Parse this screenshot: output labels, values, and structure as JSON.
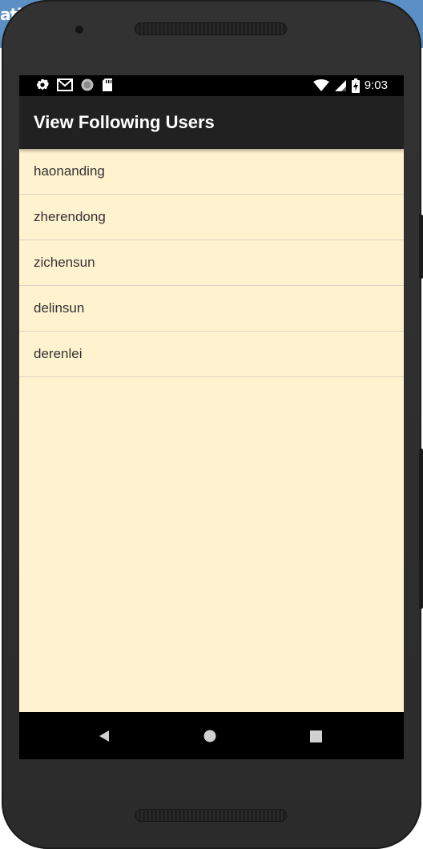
{
  "background_window": {
    "title_fragment": "ati"
  },
  "status_bar": {
    "time": "9:03",
    "left_icons": [
      "settings-icon",
      "gmail-icon",
      "sync-circle-icon",
      "sd-card-icon"
    ],
    "right_icons": [
      "wifi-icon",
      "cell-signal-icon",
      "battery-charging-icon"
    ]
  },
  "app_bar": {
    "title": "View Following Users",
    "color": "#212121"
  },
  "user_list": {
    "background": "#fff2cf",
    "items": [
      {
        "username": "haonanding"
      },
      {
        "username": "zherendong"
      },
      {
        "username": "zichensun"
      },
      {
        "username": "delinsun"
      },
      {
        "username": "derenlei"
      }
    ]
  },
  "nav_bar": {
    "buttons": [
      "back-icon",
      "home-icon",
      "recents-icon"
    ]
  }
}
